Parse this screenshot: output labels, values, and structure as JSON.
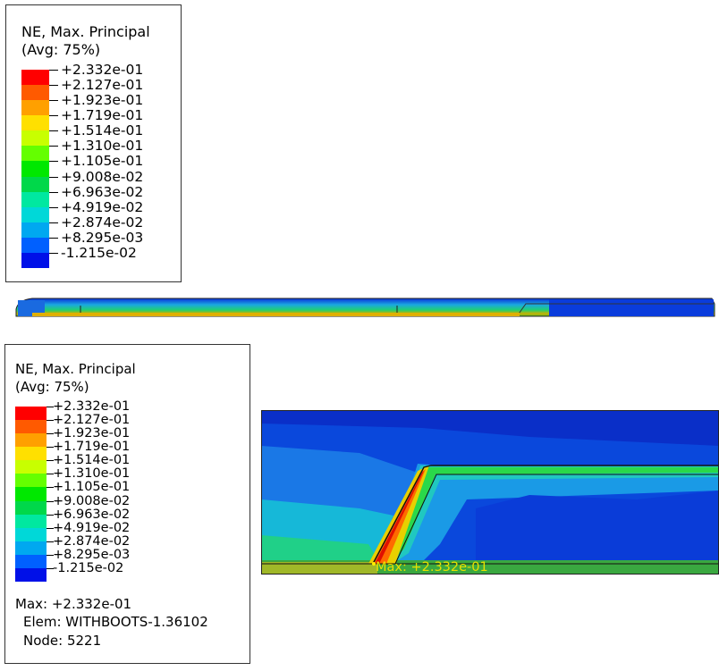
{
  "legend_top": {
    "title_line1": "NE, Max. Principal",
    "title_line2": "(Avg: 75%)",
    "values": [
      "+2.332e-01",
      "+2.127e-01",
      "+1.923e-01",
      "+1.719e-01",
      "+1.514e-01",
      "+1.310e-01",
      "+1.105e-01",
      "+9.008e-02",
      "+6.963e-02",
      "+4.919e-02",
      "+2.874e-02",
      "+8.295e-03",
      "-1.215e-02"
    ]
  },
  "legend_bottom": {
    "title_line1": "NE, Max. Principal",
    "title_line2": "(Avg: 75%)",
    "values": [
      "+2.332e-01",
      "+2.127e-01",
      "+1.923e-01",
      "+1.719e-01",
      "+1.514e-01",
      "+1.310e-01",
      "+1.105e-01",
      "+9.008e-02",
      "+6.963e-02",
      "+4.919e-02",
      "+2.874e-02",
      "+8.295e-03",
      "-1.215e-02"
    ],
    "max_line": "Max: +2.332e-01",
    "elem_line": "Elem: WITHBOOTS-1.36102",
    "node_line": "Node: 5221"
  },
  "colors": [
    "#ff0000",
    "#ff5a00",
    "#ffa000",
    "#ffe000",
    "#c8ff00",
    "#64ff00",
    "#00e800",
    "#00d84a",
    "#00e8a0",
    "#00d8d8",
    "#00a8f0",
    "#0060ff",
    "#0010e8"
  ],
  "zoom_annotation": "Max: +2.332e-01"
}
